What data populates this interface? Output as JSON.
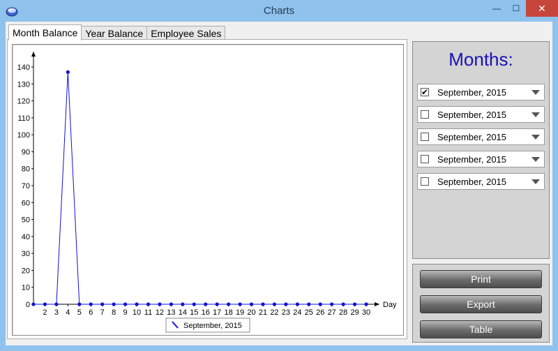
{
  "window": {
    "title": "Charts",
    "minimize_glyph": "—",
    "maximize_glyph": "☐",
    "close_glyph": "✕"
  },
  "tabs": [
    {
      "label": "Month Balance",
      "active": true
    },
    {
      "label": "Year Balance",
      "active": false
    },
    {
      "label": "Employee Sales",
      "active": false
    }
  ],
  "months_panel": {
    "title": "Months:",
    "selectors": [
      {
        "label": "September, 2015",
        "checked": true
      },
      {
        "label": "September, 2015",
        "checked": false
      },
      {
        "label": "September, 2015",
        "checked": false
      },
      {
        "label": "September, 2015",
        "checked": false
      },
      {
        "label": "September, 2015",
        "checked": false
      }
    ]
  },
  "actions": {
    "print": "Print",
    "export": "Export",
    "table": "Table"
  },
  "icons": {
    "app": "app-disk-icon",
    "dropdown": "chevron-down-icon",
    "checkbox": "checkbox-icon"
  },
  "colors": {
    "series": "#1010d8",
    "title_accent": "#1a10b8",
    "close_button": "#c7463b",
    "titlebar": "#8fc2ed"
  },
  "chart_data": {
    "type": "line",
    "title": "",
    "xlabel": "Day",
    "ylabel": "",
    "ylim": [
      0,
      140
    ],
    "yticks": [
      0,
      10,
      20,
      30,
      40,
      50,
      60,
      70,
      80,
      90,
      100,
      110,
      120,
      130,
      140
    ],
    "x": [
      1,
      2,
      3,
      4,
      5,
      6,
      7,
      8,
      9,
      10,
      11,
      12,
      13,
      14,
      15,
      16,
      17,
      18,
      19,
      20,
      21,
      22,
      23,
      24,
      25,
      26,
      27,
      28,
      29,
      30
    ],
    "xtick_labels": [
      "2",
      "3",
      "4",
      "5",
      "6",
      "7",
      "8",
      "9",
      "10",
      "11",
      "12",
      "13",
      "14",
      "15",
      "16",
      "17",
      "18",
      "19",
      "20",
      "21",
      "22",
      "23",
      "24",
      "25",
      "26",
      "27",
      "28",
      "29",
      "30"
    ],
    "series": [
      {
        "name": "September, 2015",
        "values": [
          0,
          0,
          0,
          137,
          0,
          0,
          0,
          0,
          0,
          0,
          0,
          0,
          0,
          0,
          0,
          0,
          0,
          0,
          0,
          0,
          0,
          0,
          0,
          0,
          0,
          0,
          0,
          0,
          0,
          0
        ]
      }
    ],
    "legend": "bottom-center",
    "grid": false
  }
}
